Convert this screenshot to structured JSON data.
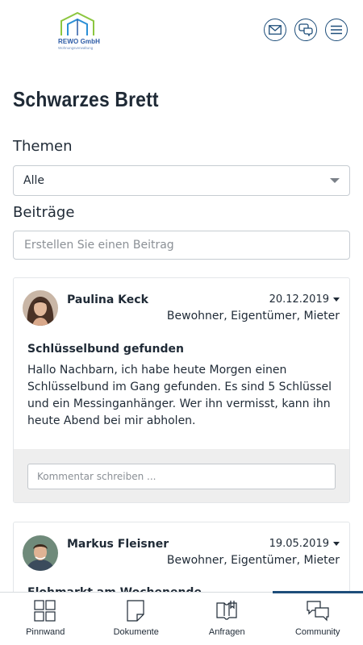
{
  "app": {
    "logo_name": "REWO GmbH",
    "logo_sub": "Wohnungsverwaltung",
    "accent": "#1e4e7a"
  },
  "header": {
    "icons": [
      "mail-icon",
      "chat-icon",
      "menu-icon"
    ]
  },
  "page": {
    "title": "Schwarzes Brett",
    "themen_label": "Themen",
    "themen_selected": "Alle",
    "beitraege_label": "Beiträge",
    "create_placeholder": "Erstellen Sie einen Beitrag"
  },
  "posts": [
    {
      "author": "Paulina Keck",
      "date": "20.12.2019",
      "roles": "Bewohner, Eigentümer, Mieter",
      "title": "Schlüsselbund gefunden",
      "body": "Hallo Nachbarn, ich habe heute Morgen einen Schlüsselbund im Gang gefunden. Es sind 5 Schlüssel und ein Messinganhänger. Wer ihn vermisst, kann ihn heute Abend bei mir abholen.",
      "comment_placeholder": "Kommentar schreiben ..."
    },
    {
      "author": "Markus Fleisner",
      "date": "19.05.2019",
      "roles": "Bewohner, Eigentümer, Mieter",
      "title": "Flohmarkt am Wochenende"
    }
  ],
  "tabs": [
    {
      "label": "Pinnwand",
      "icon": "grid-icon"
    },
    {
      "label": "Dokumente",
      "icon": "document-icon"
    },
    {
      "label": "Anfragen",
      "icon": "inquiry-icon"
    },
    {
      "label": "Community",
      "icon": "community-chat-icon",
      "active": true
    }
  ]
}
